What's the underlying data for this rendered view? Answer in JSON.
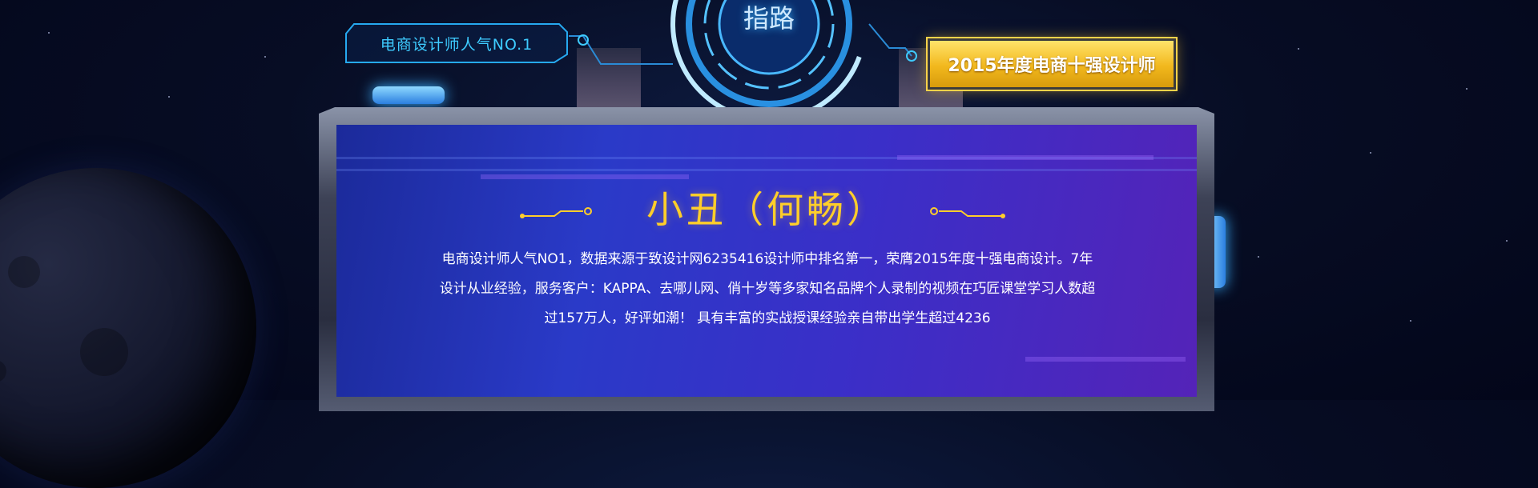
{
  "badge_left": {
    "label": "电商设计师人气NO.1"
  },
  "badge_right": {
    "label": "2015年度电商十强设计师"
  },
  "hud": {
    "label": "指路"
  },
  "profile": {
    "title": "小丑（何畅）",
    "description_lines": [
      "电商设计师人气NO1，数据来源于致设计网6235416设计师中排名第一，荣膺2015年度十强电商设计。7年",
      "设计从业经验，服务客户：KAPPA、去哪儿网、俏十岁等多家知名品牌个人录制的视频在巧匠课堂学习人数超",
      "过157万人，好评如潮！ 具有丰富的实战授课经验亲自带出学生超过4236"
    ]
  },
  "colors": {
    "accent_cyan": "#3ecbff",
    "accent_gold": "#ffce2a",
    "badge_gold": "#f2b81d",
    "screen_blue": "#2a3ac8",
    "screen_purple": "#5423b8"
  }
}
